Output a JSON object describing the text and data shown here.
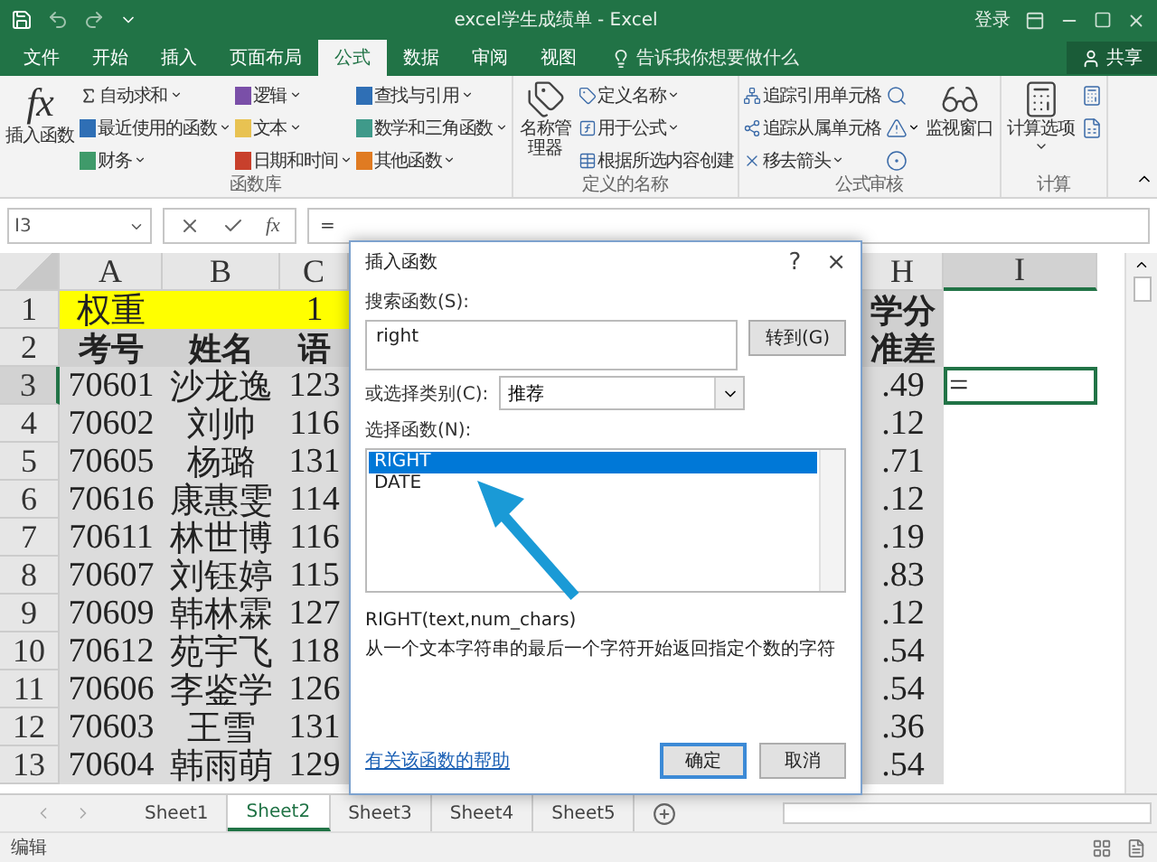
{
  "title_bar": {
    "title": "excel学生成绩单 - Excel",
    "login": "登录"
  },
  "ribbon_tabs": [
    {
      "label": "文件",
      "selected": false
    },
    {
      "label": "开始",
      "selected": false
    },
    {
      "label": "插入",
      "selected": false
    },
    {
      "label": "页面布局",
      "selected": false
    },
    {
      "label": "公式",
      "selected": true
    },
    {
      "label": "数据",
      "selected": false
    },
    {
      "label": "审阅",
      "selected": false
    },
    {
      "label": "视图",
      "selected": false
    }
  ],
  "tell_me": "告诉我你想要做什么",
  "share": "共享",
  "ribbon_groups": [
    {
      "label": "函数库",
      "items": [
        {
          "kind": "large",
          "label": "插入函数",
          "glyph": "fx"
        },
        {
          "kind": "small",
          "label": "自动求和",
          "dropdown": true,
          "color": "#3c3c3c"
        },
        {
          "kind": "small",
          "label": "最近使用的函数",
          "dropdown": true,
          "color": "#2f6fb5"
        },
        {
          "kind": "small",
          "label": "财务",
          "dropdown": true,
          "color": "#3f9a6a"
        },
        {
          "kind": "small",
          "label": "逻辑",
          "dropdown": true,
          "color": "#7a4fa8"
        },
        {
          "kind": "small",
          "label": "文本",
          "dropdown": true,
          "color": "#e8c252"
        },
        {
          "kind": "small",
          "label": "日期和时间",
          "dropdown": true,
          "color": "#c8402c"
        },
        {
          "kind": "small",
          "label": "查找与引用",
          "dropdown": true,
          "color": "#2f6fb5"
        },
        {
          "kind": "small",
          "label": "数学和三角函数",
          "dropdown": true,
          "color": "#3f9a8a"
        },
        {
          "kind": "small",
          "label": "其他函数",
          "dropdown": true,
          "color": "#e07b22"
        }
      ]
    },
    {
      "label": "定义的名称",
      "items": [
        {
          "kind": "large",
          "label": "名称管理器"
        },
        {
          "kind": "small",
          "label": "定义名称",
          "dropdown": true
        },
        {
          "kind": "small",
          "label": "用于公式",
          "dropdown": true
        },
        {
          "kind": "small",
          "label": "根据所选内容创建",
          "dropdown": false
        }
      ]
    },
    {
      "label": "公式审核",
      "items": [
        {
          "kind": "small",
          "label": "追踪引用单元格",
          "dropdown": false
        },
        {
          "kind": "small",
          "label": "追踪从属单元格",
          "dropdown": false
        },
        {
          "kind": "small",
          "label": "移去箭头",
          "dropdown": true
        },
        {
          "kind": "icon",
          "dropdown": false
        },
        {
          "kind": "icon",
          "dropdown": true
        },
        {
          "kind": "icon",
          "dropdown": false
        },
        {
          "kind": "large",
          "label": "监视窗口"
        }
      ]
    },
    {
      "label": "计算",
      "items": [
        {
          "kind": "large",
          "label": "计算选项",
          "dropdown": true
        },
        {
          "kind": "icon",
          "dropdown": false
        },
        {
          "kind": "icon",
          "dropdown": false
        }
      ]
    }
  ],
  "formula_bar": {
    "name_box": "I3",
    "fx": "fx",
    "formula": "="
  },
  "columns": [
    {
      "label": "A",
      "selected": false
    },
    {
      "label": "B",
      "selected": false
    },
    {
      "label": "C",
      "selected": false
    },
    {
      "label": "H",
      "selected": false
    },
    {
      "label": "I",
      "selected": true
    }
  ],
  "rows": [
    {
      "label": "1",
      "selected": false,
      "cells": [
        {
          "text": "权重",
          "kind": "highlight",
          "selected": false
        },
        {
          "kind": "highlight",
          "selected": false
        },
        {
          "text": "1",
          "kind": "highlight",
          "selected": false
        },
        {
          "text": "学分",
          "kind": "heading",
          "selected": false
        },
        {
          "kind": "plain",
          "selected": false
        }
      ]
    },
    {
      "label": "2",
      "selected": false,
      "cells": [
        {
          "text": "考号",
          "kind": "heading",
          "selected": false
        },
        {
          "text": "姓名",
          "kind": "heading",
          "selected": false
        },
        {
          "text": "语",
          "kind": "heading",
          "selected": false
        },
        {
          "text": "准差",
          "kind": "heading",
          "selected": false
        },
        {
          "kind": "plain",
          "selected": false
        }
      ]
    },
    {
      "label": "3",
      "selected": true,
      "cells": [
        {
          "text": "70601",
          "kind": "shaded",
          "selected": false
        },
        {
          "text": "沙龙逸",
          "kind": "shaded",
          "selected": false
        },
        {
          "text": "123",
          "kind": "shaded",
          "selected": false
        },
        {
          "text": ".49",
          "kind": "shaded",
          "selected": false
        },
        {
          "text": "=",
          "kind": "plain",
          "selected": true
        }
      ]
    },
    {
      "label": "4",
      "selected": false,
      "cells": [
        {
          "text": "70602",
          "kind": "shaded",
          "selected": false
        },
        {
          "text": "刘帅",
          "kind": "shaded",
          "selected": false
        },
        {
          "text": "116",
          "kind": "shaded",
          "selected": false
        },
        {
          "text": ".12",
          "kind": "shaded",
          "selected": false
        },
        {
          "kind": "plain",
          "selected": false
        }
      ]
    },
    {
      "label": "5",
      "selected": false,
      "cells": [
        {
          "text": "70605",
          "kind": "shaded",
          "selected": false
        },
        {
          "text": "杨璐",
          "kind": "shaded",
          "selected": false
        },
        {
          "text": "131",
          "kind": "shaded",
          "selected": false
        },
        {
          "text": ".71",
          "kind": "shaded",
          "selected": false
        },
        {
          "kind": "plain",
          "selected": false
        }
      ]
    },
    {
      "label": "6",
      "selected": false,
      "cells": [
        {
          "text": "70616",
          "kind": "shaded",
          "selected": false
        },
        {
          "text": "康惠雯",
          "kind": "shaded",
          "selected": false
        },
        {
          "text": "114",
          "kind": "shaded",
          "selected": false
        },
        {
          "text": ".12",
          "kind": "shaded",
          "selected": false
        },
        {
          "kind": "plain",
          "selected": false
        }
      ]
    },
    {
      "label": "7",
      "selected": false,
      "cells": [
        {
          "text": "70611",
          "kind": "shaded",
          "selected": false
        },
        {
          "text": "林世博",
          "kind": "shaded",
          "selected": false
        },
        {
          "text": "116",
          "kind": "shaded",
          "selected": false
        },
        {
          "text": ".19",
          "kind": "shaded",
          "selected": false
        },
        {
          "kind": "plain",
          "selected": false
        }
      ]
    },
    {
      "label": "8",
      "selected": false,
      "cells": [
        {
          "text": "70607",
          "kind": "shaded",
          "selected": false
        },
        {
          "text": "刘钰婷",
          "kind": "shaded",
          "selected": false
        },
        {
          "text": "115",
          "kind": "shaded",
          "selected": false
        },
        {
          "text": ".83",
          "kind": "shaded",
          "selected": false
        },
        {
          "kind": "plain",
          "selected": false
        }
      ]
    },
    {
      "label": "9",
      "selected": false,
      "cells": [
        {
          "text": "70609",
          "kind": "shaded",
          "selected": false
        },
        {
          "text": "韩林霖",
          "kind": "shaded",
          "selected": false
        },
        {
          "text": "127",
          "kind": "shaded",
          "selected": false
        },
        {
          "text": ".12",
          "kind": "shaded",
          "selected": false
        },
        {
          "kind": "plain",
          "selected": false
        }
      ]
    },
    {
      "label": "10",
      "selected": false,
      "cells": [
        {
          "text": "70612",
          "kind": "shaded",
          "selected": false
        },
        {
          "text": "苑宇飞",
          "kind": "shaded",
          "selected": false
        },
        {
          "text": "118",
          "kind": "shaded",
          "selected": false
        },
        {
          "text": ".54",
          "kind": "shaded",
          "selected": false
        },
        {
          "kind": "plain",
          "selected": false
        }
      ]
    },
    {
      "label": "11",
      "selected": false,
      "cells": [
        {
          "text": "70606",
          "kind": "shaded",
          "selected": false
        },
        {
          "text": "李鉴学",
          "kind": "shaded",
          "selected": false
        },
        {
          "text": "126",
          "kind": "shaded",
          "selected": false
        },
        {
          "text": ".54",
          "kind": "shaded",
          "selected": false
        },
        {
          "kind": "plain",
          "selected": false
        }
      ]
    },
    {
      "label": "12",
      "selected": false,
      "cells": [
        {
          "text": "70603",
          "kind": "shaded",
          "selected": false
        },
        {
          "text": "王雪",
          "kind": "shaded",
          "selected": false
        },
        {
          "text": "131",
          "kind": "shaded",
          "selected": false
        },
        {
          "text": ".36",
          "kind": "shaded",
          "selected": false
        },
        {
          "kind": "plain",
          "selected": false
        }
      ]
    },
    {
      "label": "13",
      "selected": false,
      "cells": [
        {
          "text": "70604",
          "kind": "shaded",
          "selected": false
        },
        {
          "text": "韩雨萌",
          "kind": "shaded",
          "selected": false
        },
        {
          "text": "129",
          "kind": "shaded",
          "selected": false
        },
        {
          "text": ".54",
          "kind": "shaded",
          "selected": false
        },
        {
          "kind": "plain",
          "selected": false
        }
      ]
    }
  ],
  "sheet_tabs": [
    {
      "label": "Sheet1",
      "selected": false
    },
    {
      "label": "Sheet2",
      "selected": true
    },
    {
      "label": "Sheet3",
      "selected": false
    },
    {
      "label": "Sheet4",
      "selected": false
    },
    {
      "label": "Sheet5",
      "selected": false
    }
  ],
  "status_bar": {
    "mode": "编辑"
  },
  "dialog": {
    "title": "插入函数",
    "help": "?",
    "close": "×",
    "search_label": "搜索函数(S):",
    "search_value": "right",
    "go_button": "转到(G)",
    "category_label": "或选择类别(C):",
    "category_value": "推荐",
    "function_label": "选择函数(N):",
    "functions": [
      {
        "label": "RIGHT",
        "selected": true
      },
      {
        "label": "DATE",
        "selected": false
      }
    ],
    "syntax": "RIGHT(text,num_chars)",
    "description": "从一个文本字符串的最后一个字符开始返回指定个数的字符",
    "help_link": "有关该函数的帮助",
    "buttons": [
      {
        "label": "确定",
        "kind": "primary"
      },
      {
        "label": "取消",
        "kind": "normal"
      }
    ]
  }
}
